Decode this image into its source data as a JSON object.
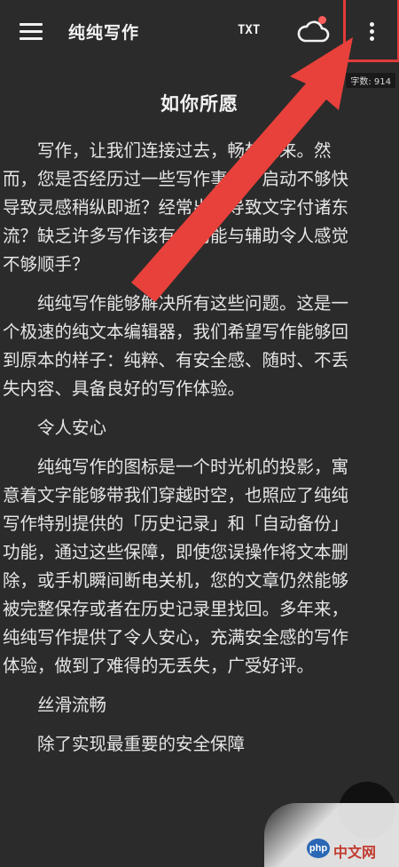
{
  "toolbar": {
    "title": "纯纯写作",
    "txt_label": "TXT",
    "menu_icon": "hamburger-menu-icon",
    "cloud_icon": "cloud-sync-icon",
    "more_icon": "more-vertical-icon",
    "sync_dot_color": "#ff5c5c"
  },
  "word_count": "字数: 914",
  "document": {
    "title": "如你所愿",
    "paragraphs": [
      {
        "lines": [
          "写作，让我们连接过去，畅想未来。然",
          "而，您是否经历过一些写作事件：启动不够快",
          "导致灵感稍纵即逝？经常出错导致文字付诸东",
          "流？缺乏许多写作该有的功能与辅助令人感觉",
          "不够顺手？"
        ]
      },
      {
        "lines": [
          "纯纯写作能够解决所有这些问题。这是一",
          "个极速的纯文本编辑器，我们希望写作能够回",
          "到原本的样子：纯粹、有安全感、随时、不丢",
          "失内容、具备良好的写作体验。"
        ]
      },
      {
        "heading": "令人安心"
      },
      {
        "lines": [
          "纯纯写作的图标是一个时光机的投影，寓",
          "意着文字能够带我们穿越时空，也照应了纯纯",
          "写作特别提供的「历史记录」和「自动备份」",
          "功能，通过这些保障，即使您误操作将文本删",
          "除，或手机瞬间断电关机，您的文章仍然能够",
          "被完整保存或者在历史记录里找回。多年来，",
          "纯纯写作提供了令人安心，充满安全感的写作",
          "体验，做到了难得的无丢失，广受好评。"
        ]
      },
      {
        "heading": "丝滑流畅"
      },
      {
        "lines": [
          "除了实现最重要的安全保障"
        ]
      }
    ]
  },
  "annotation": {
    "arrow_color": "#e8413b",
    "highlight_color": "#e23a3a"
  },
  "watermark": {
    "logo_text": "php",
    "site_text": "中文网"
  }
}
